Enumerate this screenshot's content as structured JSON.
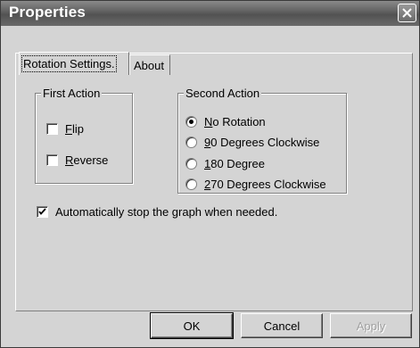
{
  "window": {
    "title": "Properties"
  },
  "tabs": [
    {
      "label": "Rotation Settings.",
      "active": true
    },
    {
      "label": "About",
      "active": false
    }
  ],
  "first_action": {
    "label": "First Action",
    "options": [
      {
        "key": "F",
        "rest": "lip",
        "checked": false
      },
      {
        "key": "R",
        "rest": "everse",
        "checked": false
      }
    ]
  },
  "second_action": {
    "label": "Second Action",
    "options": [
      {
        "key": "N",
        "rest": "o Rotation",
        "selected": true
      },
      {
        "key": "9",
        "rest": "0 Degrees Clockwise",
        "selected": false
      },
      {
        "key": "1",
        "rest": "80 Degree",
        "selected": false
      },
      {
        "key": "2",
        "rest": "70 Degrees Clockwise",
        "selected": false
      }
    ]
  },
  "auto_stop": {
    "label": "Automatically stop the graph when needed.",
    "checked": true
  },
  "buttons": {
    "ok": "OK",
    "cancel": "Cancel",
    "apply": "Apply"
  }
}
